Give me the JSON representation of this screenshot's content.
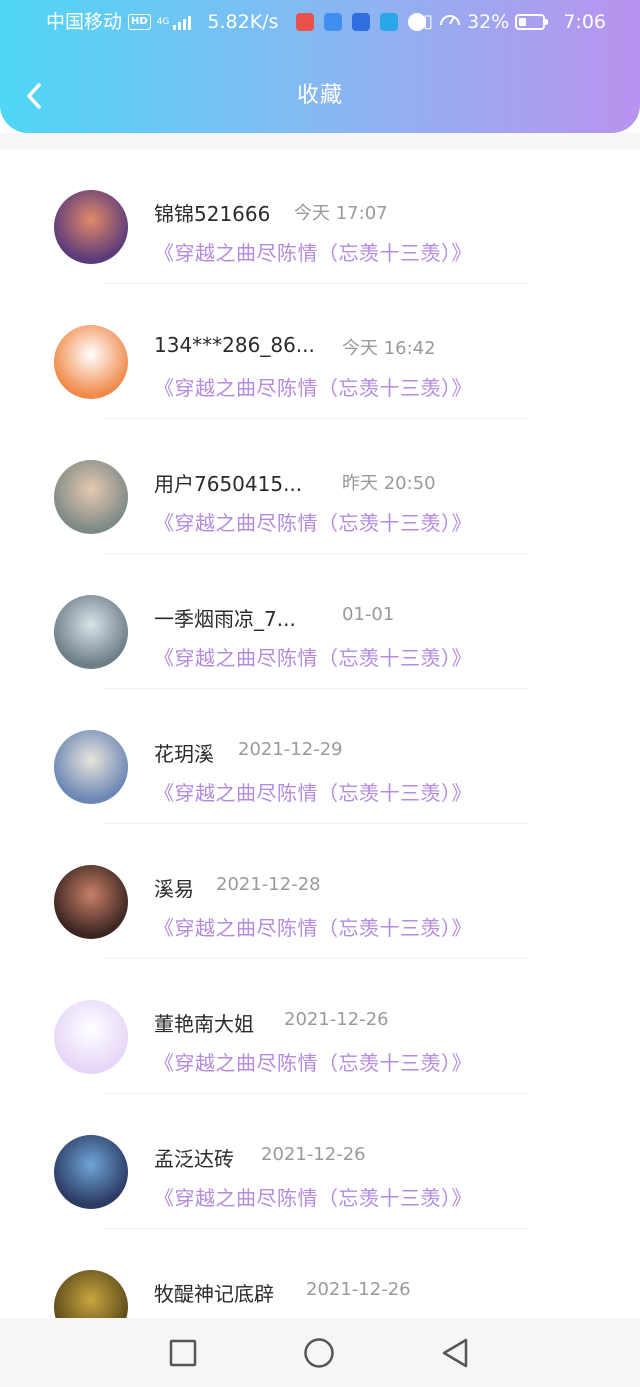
{
  "status_bar": {
    "carrier": "中国移动",
    "hd": "HD",
    "network": "4G",
    "speed": "5.82K/s",
    "battery_percent": "32%",
    "battery_level": 0.32,
    "time": "7:06"
  },
  "header": {
    "title": "收藏"
  },
  "items": [
    {
      "name": "锦锦521666",
      "time": "今天 17:07",
      "book": "《穿越之曲尽陈情（忘羡十三羡）》",
      "avatar": "avatar-woman-red-dress",
      "colors": [
        "#5b3a7a",
        "#e08a6a"
      ]
    },
    {
      "name": "134***286_86...",
      "time": "今天 16:42",
      "book": "《穿越之曲尽陈情（忘羡十三羡）》",
      "avatar": "avatar-cartoon-dog",
      "colors": [
        "#f08a4a",
        "#ffffff"
      ]
    },
    {
      "name": "用户7650415...",
      "time": "昨天 20:50",
      "book": "《穿越之曲尽陈情（忘羡十三羡）》",
      "avatar": "avatar-photo-person",
      "colors": [
        "#7d8a86",
        "#e6c9b0"
      ]
    },
    {
      "name": "一季烟雨凉_7...",
      "time": "01-01",
      "book": "《穿越之曲尽陈情（忘羡十三羡）》",
      "avatar": "avatar-ancient-figure",
      "colors": [
        "#6e7d86",
        "#d9e3ea"
      ]
    },
    {
      "name": "花玥溪",
      "time": "2021-12-29",
      "book": "《穿越之曲尽陈情（忘羡十三羡）》",
      "avatar": "avatar-young-man",
      "colors": [
        "#6a87b4",
        "#e9e4dc"
      ]
    },
    {
      "name": "溪易",
      "time": "2021-12-28",
      "book": "《穿越之曲尽陈情（忘羡十三羡）》",
      "avatar": "avatar-woman-dark",
      "colors": [
        "#3a2522",
        "#c98066"
      ]
    },
    {
      "name": "董艳南大姐",
      "time": "2021-12-26",
      "book": "《穿越之曲尽陈情（忘羡十三羡）》",
      "avatar": "avatar-default-chat",
      "colors": [
        "#e6d6f8",
        "#ffffff"
      ]
    },
    {
      "name": "孟泛达砖",
      "time": "2021-12-26",
      "book": "《穿越之曲尽陈情（忘羡十三羡）》",
      "avatar": "avatar-robot",
      "colors": [
        "#2b3a63",
        "#6fa6d8"
      ]
    },
    {
      "name": "牧醍神记底辟",
      "time": "2021-12-26",
      "book": "",
      "avatar": "avatar-gold-armor",
      "colors": [
        "#5a4a1a",
        "#c9a640"
      ]
    }
  ],
  "nav_bar": {
    "buttons": [
      "recent-apps-square-icon",
      "home-circle-icon",
      "back-triangle-icon"
    ]
  }
}
